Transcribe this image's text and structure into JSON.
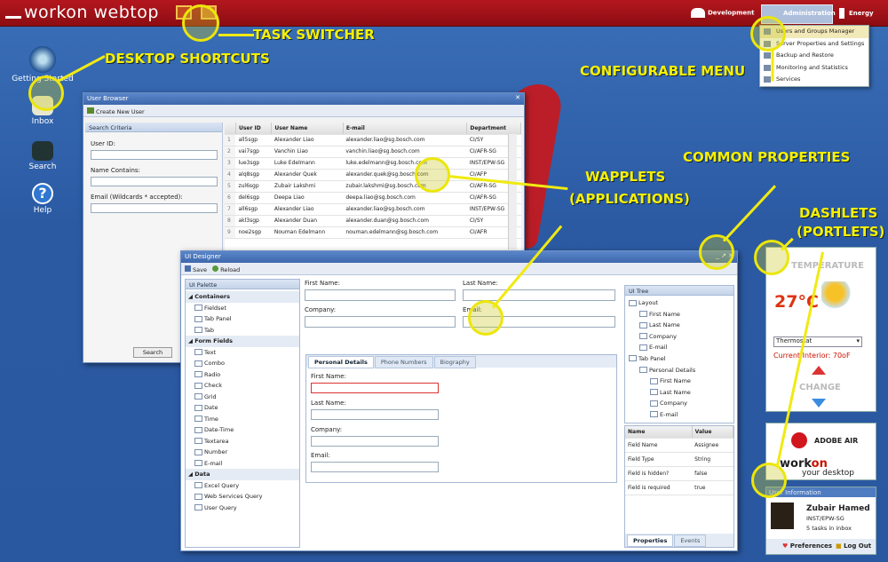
{
  "app": {
    "title": "workon webtop"
  },
  "topbar": {
    "development": "Development",
    "administration": "Administration",
    "energy": "Energy"
  },
  "admin_menu": {
    "items": [
      "Users and Groups Manager",
      "Server Properties and Settings",
      "Backup and Restore",
      "Monitoring and Statistics",
      "Services"
    ]
  },
  "annotations": {
    "task_switcher": "TASK SWITCHER",
    "desktop_shortcuts": "DESKTOP SHORTCUTS",
    "configurable_menu": "CONFIGURABLE MENU",
    "common_properties": "COMMON PROPERTIES",
    "wapplets": "WAPPLETS",
    "applications": "(APPLICATIONS)",
    "dashlets": "DASHLETS",
    "portlets": "(PORTLETS)"
  },
  "desktop": {
    "shortcuts": [
      "Getting Started",
      "Inbox",
      "Search",
      "Help"
    ]
  },
  "user_browser": {
    "title": "User Browser",
    "create_label": "Create New User",
    "criteria_title": "Search Criteria",
    "user_id_label": "User ID:",
    "name_label": "Name Contains:",
    "email_label": "Email (Wildcards * accepted):",
    "search_button": "Search",
    "columns": [
      "",
      "User ID",
      "User Name",
      "E-mail",
      "Department"
    ],
    "rows": [
      [
        "1",
        "all5sgp",
        "Alexander Liao",
        "alexander.liao@sg.bosch.com",
        "CI/SY"
      ],
      [
        "2",
        "vai7sgp",
        "Vanchin Liao",
        "vanchin.liao@sg.bosch.com",
        "CI/AFR-SG"
      ],
      [
        "3",
        "lue3sgp",
        "Luke Edelmann",
        "luke.edelmann@sg.bosch.com",
        "INST/EPW-SG"
      ],
      [
        "4",
        "alq8sgp",
        "Alexander Quek",
        "alexander.quek@sg.bosch.com",
        "CI/AFP"
      ],
      [
        "5",
        "zul6sgp",
        "Zubair Lakshmi",
        "zubair.lakshmi@sg.bosch.com",
        "CI/AFR-SG"
      ],
      [
        "6",
        "del6sgp",
        "Deepa Liao",
        "deepa.liao@sg.bosch.com",
        "CI/AFR-SG"
      ],
      [
        "7",
        "all6sgp",
        "Alexander Liao",
        "alexander.liao@sg.bosch.com",
        "INST/EPW-SG"
      ],
      [
        "8",
        "akl3sgp",
        "Alexander Duan",
        "alexander.duan@sg.bosch.com",
        "CI/SY"
      ],
      [
        "9",
        "noe2sgp",
        "Nouman Edelmann",
        "nouman.edelmann@sg.bosch.com",
        "CI/AFR"
      ]
    ]
  },
  "ui_designer": {
    "title": "UI Designer",
    "save": "Save",
    "reload": "Reload",
    "palette_title": "UI Palette",
    "palette": [
      {
        "type": "head",
        "label": "Containers"
      },
      {
        "type": "item",
        "label": "Fieldset"
      },
      {
        "type": "item",
        "label": "Tab Panel"
      },
      {
        "type": "item",
        "label": "Tab"
      },
      {
        "type": "head",
        "label": "Form Fields"
      },
      {
        "type": "item",
        "label": "Text"
      },
      {
        "type": "item",
        "label": "Combo"
      },
      {
        "type": "item",
        "label": "Radio"
      },
      {
        "type": "item",
        "label": "Check"
      },
      {
        "type": "item",
        "label": "Grid"
      },
      {
        "type": "item",
        "label": "Date"
      },
      {
        "type": "item",
        "label": "Time"
      },
      {
        "type": "item",
        "label": "Date-Time"
      },
      {
        "type": "item",
        "label": "Textarea"
      },
      {
        "type": "item",
        "label": "Number"
      },
      {
        "type": "item",
        "label": "E-mail"
      },
      {
        "type": "head",
        "label": "Data"
      },
      {
        "type": "item",
        "label": "Excel Query"
      },
      {
        "type": "item",
        "label": "Web Services Query"
      },
      {
        "type": "item",
        "label": "User Query"
      }
    ],
    "form": {
      "first_name": "First Name:",
      "last_name": "Last Name:",
      "company": "Company:",
      "email": "Email:"
    },
    "tabs": [
      "Personal Details",
      "Phone Numbers",
      "Biography"
    ],
    "tab_form": {
      "first_name": "First Name:",
      "last_name": "Last Name:",
      "company": "Company:",
      "email": "Email:"
    },
    "tree_title": "UI Tree",
    "tree": [
      "Layout",
      "First Name",
      "Last Name",
      "Company",
      "E-mail",
      "Tab Panel",
      "Personal Details",
      "First Name",
      "Last Name",
      "Company",
      "E-mail"
    ],
    "props": {
      "name_col": "Name",
      "value_col": "Value",
      "rows": [
        [
          "Field Name",
          "Assignee"
        ],
        [
          "Field Type",
          "String"
        ],
        [
          "Field is hidden?",
          "false"
        ],
        [
          "Field is required",
          "true"
        ]
      ]
    },
    "bottom_tabs": [
      "Properties",
      "Events"
    ]
  },
  "dashlets": {
    "temperature": {
      "title": "TEMPERATURE",
      "value": "27°C",
      "select": "Thermostat",
      "interior": "Current Interior: 70oF",
      "change": "CHANGE"
    },
    "adobe": {
      "label": "ADOBE AIR",
      "brand_a": "work",
      "brand_b": "on",
      "tagline": "your desktop"
    },
    "user": {
      "title": "User Information",
      "name": "Zubair Hamed",
      "dept": "INST/EPW-SG",
      "tasks": "5 tasks in inbox",
      "preferences": "Preferences",
      "logout": "Log Out"
    }
  }
}
